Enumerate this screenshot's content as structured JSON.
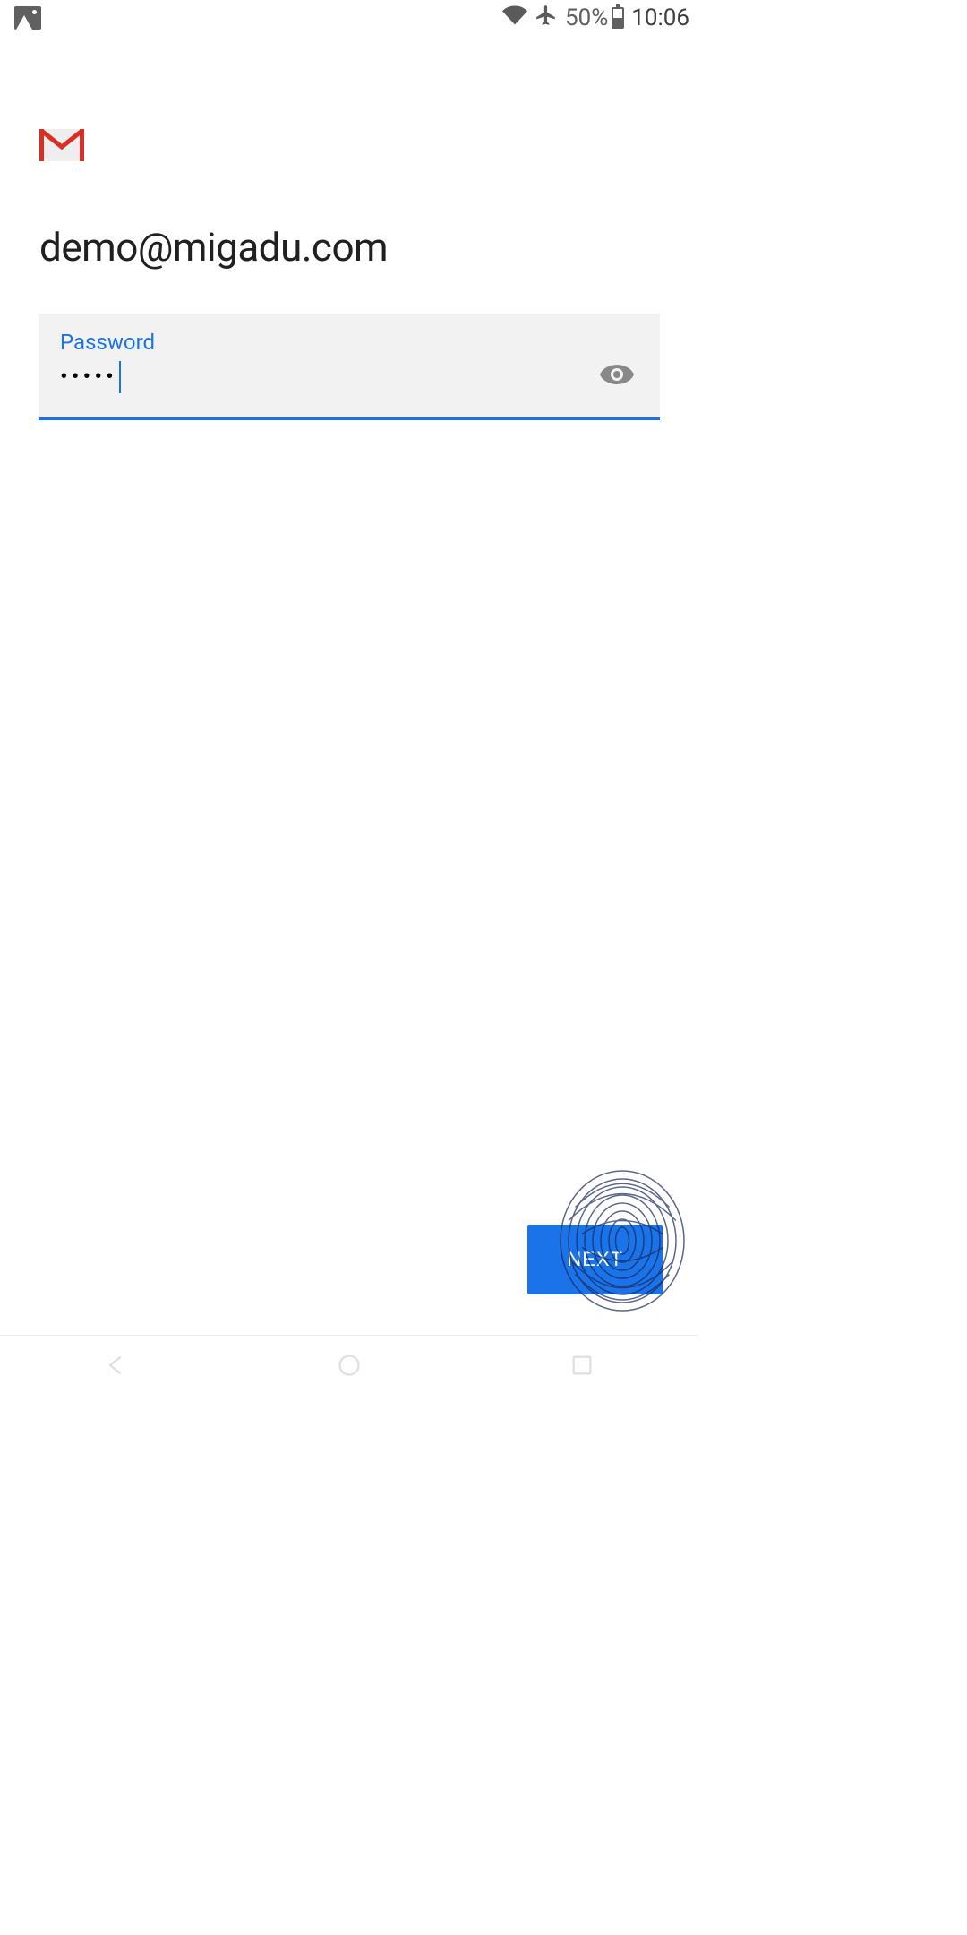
{
  "status_bar": {
    "battery_percent": "50%",
    "clock": "10:06"
  },
  "account": {
    "email": "demo@migadu.com"
  },
  "password_field": {
    "label": "Password",
    "masked_value": "•••••"
  },
  "actions": {
    "next_label": "NEXT"
  }
}
